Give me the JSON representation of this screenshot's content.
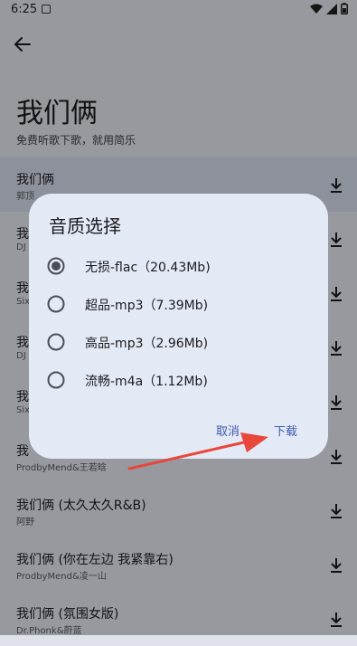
{
  "status": {
    "time": "6:25"
  },
  "header": {
    "title": "我们俩",
    "subtitle": "免费听歌下歌，就用简乐"
  },
  "songs": [
    {
      "title": "我们俩",
      "artist": "郭顶"
    },
    {
      "title": "我",
      "artist": "DJ"
    },
    {
      "title": "我",
      "artist": "Six"
    },
    {
      "title": "我",
      "artist": "DJ"
    },
    {
      "title": "我",
      "artist": "Six"
    },
    {
      "title": "我",
      "artist": "ProdbyMend&王若晗"
    },
    {
      "title": "我们俩 (太久太久R&B)",
      "artist": "阿野"
    },
    {
      "title": "我们俩 (你在左边 我紧靠右)",
      "artist": "ProdbyMend&凌一山"
    },
    {
      "title": "我们俩 (氛围女版)",
      "artist": "Dr.Phonk&蔚蓝"
    }
  ],
  "dialog": {
    "title": "音质选择",
    "options": [
      {
        "label": "无损-flac（20.43Mb)",
        "selected": true
      },
      {
        "label": "超品-mp3（7.39Mb)",
        "selected": false
      },
      {
        "label": "高品-mp3（2.96Mb)",
        "selected": false
      },
      {
        "label": "流畅-m4a（1.12Mb)",
        "selected": false
      }
    ],
    "cancel_label": "取消",
    "confirm_label": "下载"
  },
  "colors": {
    "accent": "#3d5ba9",
    "annotation_arrow": "#e8473b"
  }
}
